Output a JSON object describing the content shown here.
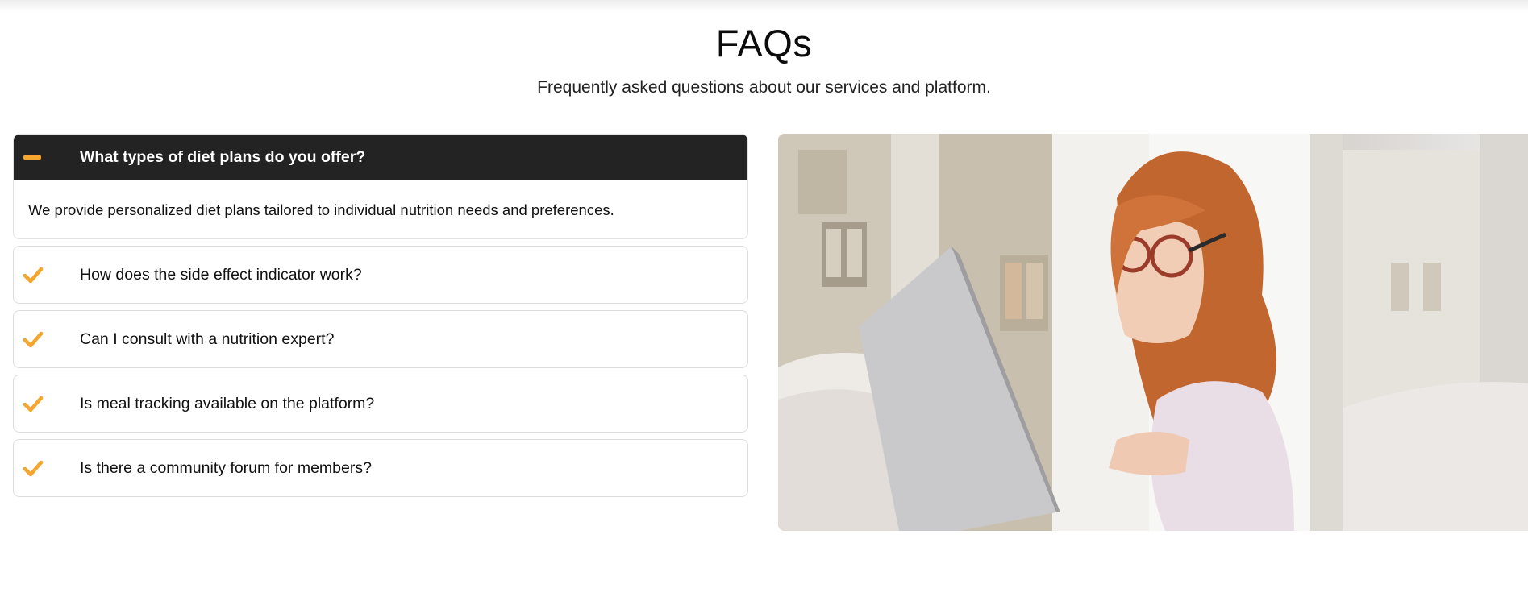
{
  "section": {
    "title": "FAQs",
    "subtitle": "Frequently asked questions about our services and platform."
  },
  "faqs": [
    {
      "question": "What types of diet plans do you offer?",
      "answer": "We provide personalized diet plans tailored to individual nutrition needs and preferences.",
      "open": true,
      "icon": "minus-icon"
    },
    {
      "question": "How does the side effect indicator work?",
      "open": false,
      "icon": "check-icon"
    },
    {
      "question": "Can I consult with a nutrition expert?",
      "open": false,
      "icon": "check-icon"
    },
    {
      "question": "Is meal tracking available on the platform?",
      "open": false,
      "icon": "check-icon"
    },
    {
      "question": "Is there a community forum for members?",
      "open": false,
      "icon": "check-icon"
    }
  ],
  "image": {
    "subject": "girl-with-glasses-using-laptop-photo"
  },
  "colors": {
    "accent": "#f6a62e",
    "open_header_bg": "#232323"
  }
}
